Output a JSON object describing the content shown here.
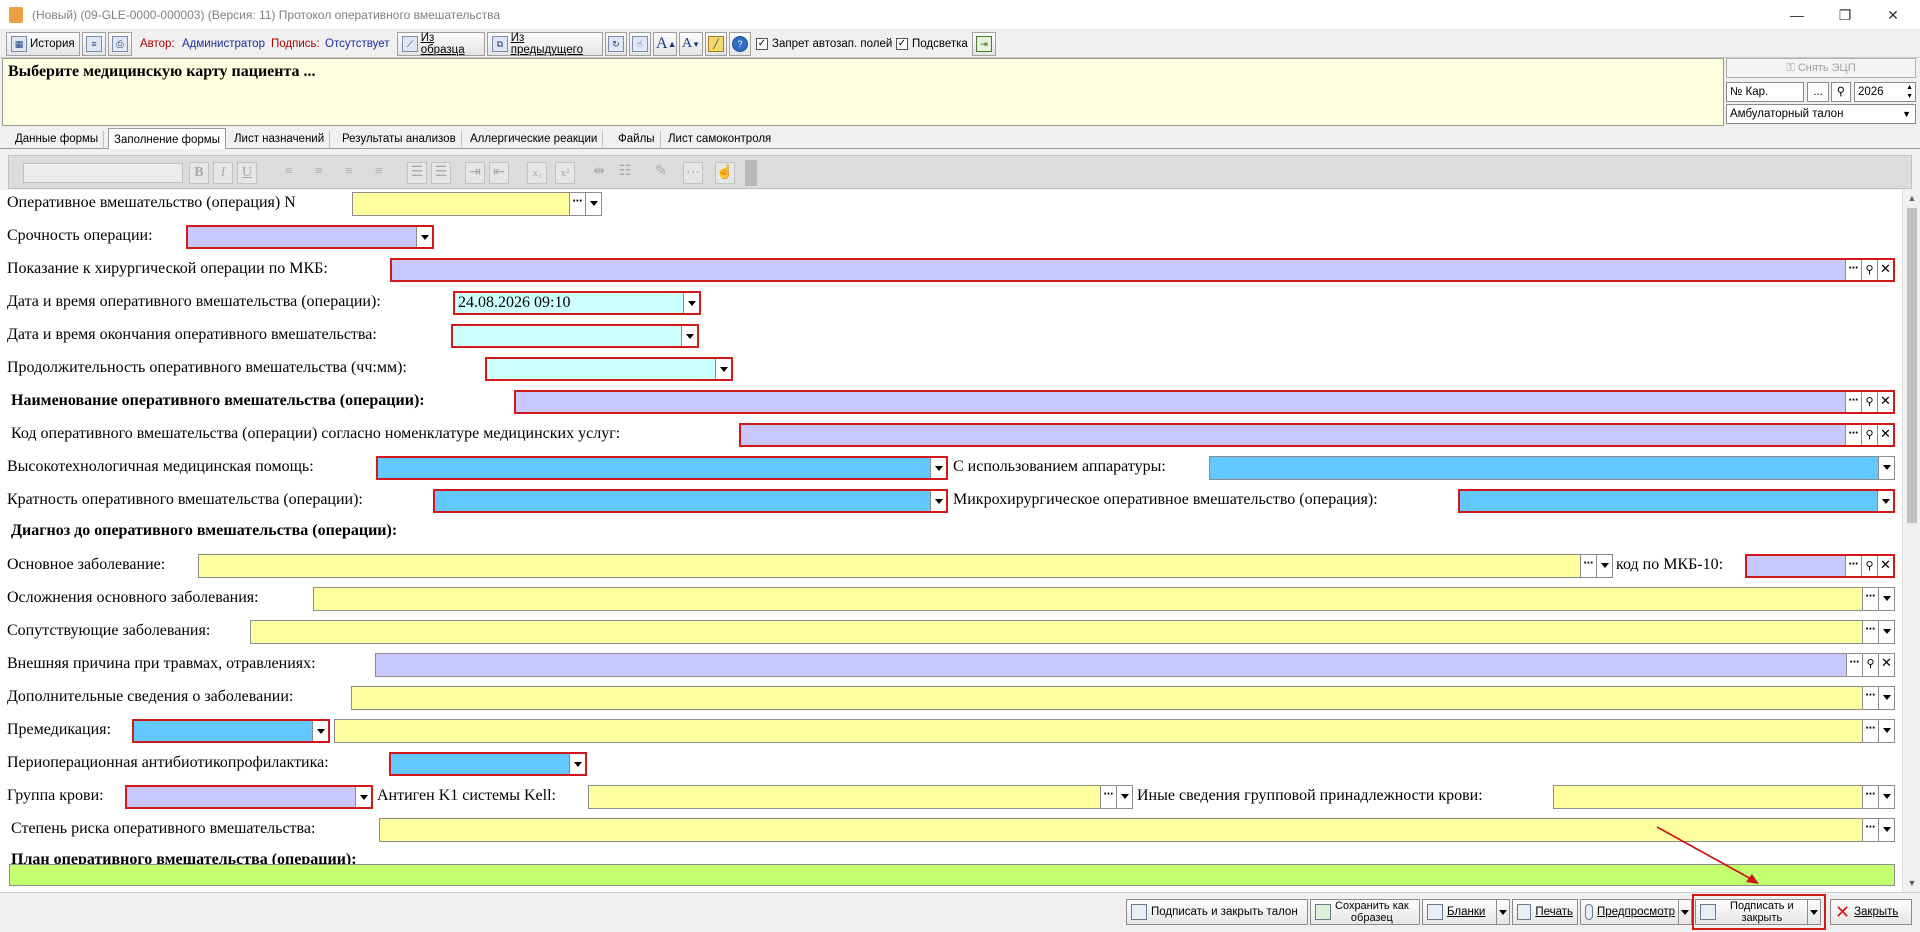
{
  "window": {
    "title": "(Новый) (09-GLE-0000-000003) (Версия: 11) Протокол оперативного вмешательства",
    "minimize": "—",
    "restore": "❐",
    "close": "✕"
  },
  "toolbar": {
    "history": "История",
    "author_label": "Автор:",
    "author_value": "Администратор",
    "sign_label": "Подпись:",
    "sign_value": "Отсутствует",
    "from_template": "Из образца",
    "from_previous": "Из предыдущего",
    "autofill_lock": "Запрет автозап. полей",
    "highlight": "Подсветка"
  },
  "header": {
    "message": "Выберите медицинскую карту пациента ...",
    "remove_ecp": "Снять ЭЦП",
    "card_no": "№ Кар.",
    "dots": "...",
    "year": "2026",
    "talon_type": "Амбулаторный талон"
  },
  "tabs": [
    "Данные формы",
    "Заполнение формы",
    "Лист назначений",
    "Результаты анализов",
    "Аллергические реакции",
    "Файлы",
    "Лист самоконтроля"
  ],
  "form": {
    "op_number": "Оперативное вмешательство (операция) N",
    "urgency": "Срочность операции:",
    "mkb_indication": "Показание к хирургической операции по МКБ:",
    "op_datetime": "Дата и время оперативного вмешательства (операции):",
    "op_datetime_value": "24.08.2026 09:10",
    "op_end": "Дата и время окончания оперативного вмешательства:",
    "op_duration": "Продолжительность оперативного вмешательства (чч:мм):",
    "op_name": "Наименование оперативного вмешательства (операции):",
    "op_code": "Код оперативного вмешательства (операции) согласно номенклатуре медицинских услуг:",
    "hitech": "Высокотехнологичная медицинская помощь:",
    "equipment": "С использованием аппаратуры:",
    "multiplicity": "Кратность оперативного вмешательства (операции):",
    "microsurgery": "Микрохирургическое оперативное вмешательство (операция):",
    "diag_before": "Диагноз до оперативного вмешательства (операции):",
    "main_disease": "Основное заболевание:",
    "mkb10_code": "код по МКБ-10:",
    "complications": "Осложнения основного заболевания:",
    "comorbid": "Сопутствующие заболевания:",
    "external_cause": "Внешняя причина при травмах, отравлениях:",
    "additional": "Дополнительные сведения о заболевании:",
    "premedication": "Премедикация:",
    "antibiotic": "Периоперационная антибиотикопрофилактика:",
    "blood_group": "Группа крови:",
    "kell": "Антиген K1 системы Kell:",
    "other_blood": "Иные сведения групповой принадлежности крови:",
    "risk": "Степень риска оперативного вмешательства:",
    "plan": "План оперативного вмешательства (операции):"
  },
  "bottom": {
    "sign_close_talon": "Подписать и закрыть талон",
    "save_template_1": "Сохранить как",
    "save_template_2": "образец",
    "blanks": "Бланки",
    "print": "Печать",
    "preview": "Предпросмотр",
    "sign_close_1": "Подписать и",
    "sign_close_2": "закрыть",
    "close": "Закрыть"
  },
  "colors": {
    "yellow_field": "#ffff9f",
    "lavender_field": "#c8c8ff",
    "cyan_field": "#cdffff",
    "blue_field": "#63c8ff",
    "green_field": "#c3ff6e",
    "required_border": "#d21919"
  }
}
